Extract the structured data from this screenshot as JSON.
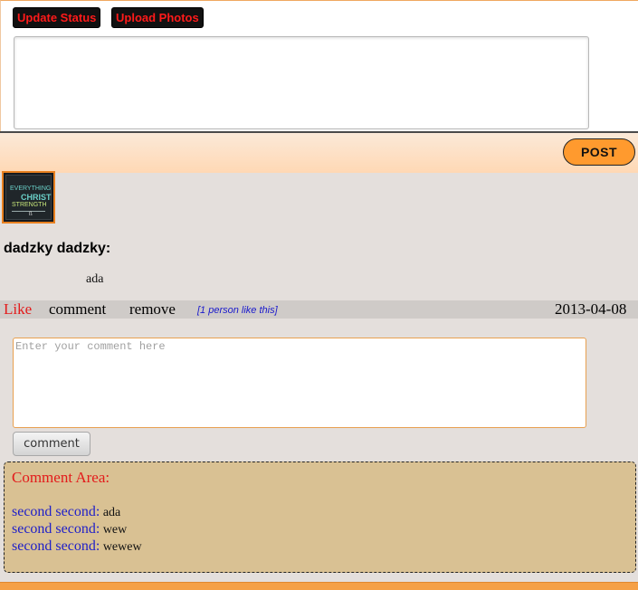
{
  "status_box": {
    "update_status_label": "Update Status",
    "upload_photos_label": "Upload Photos",
    "status_value": ""
  },
  "post_button_label": "POST",
  "post": {
    "author": "dadzky dadzky:",
    "text": "ada",
    "avatar_text": {
      "line1": "EVERYTHING",
      "line2": "CHRIST",
      "line3": "STRENGTH",
      "line4": "ß"
    },
    "actions": {
      "like": "Like",
      "comment": "comment",
      "remove": "remove",
      "like_count": "[1 person like this]"
    },
    "date": "2013-04-08",
    "comment_placeholder": "Enter your comment here",
    "comment_button_label": "comment",
    "comment_area": {
      "title": "Comment Area:",
      "comments": [
        {
          "author": "second second:",
          "text": "ada"
        },
        {
          "author": "second second:",
          "text": "wew"
        },
        {
          "author": "second second:",
          "text": "wewew"
        }
      ]
    }
  },
  "colors": {
    "accent_orange": "#ff9a2e",
    "like_red": "#e31b1b",
    "link_blue": "#1a1acc",
    "comment_area_bg": "#d9c193"
  }
}
